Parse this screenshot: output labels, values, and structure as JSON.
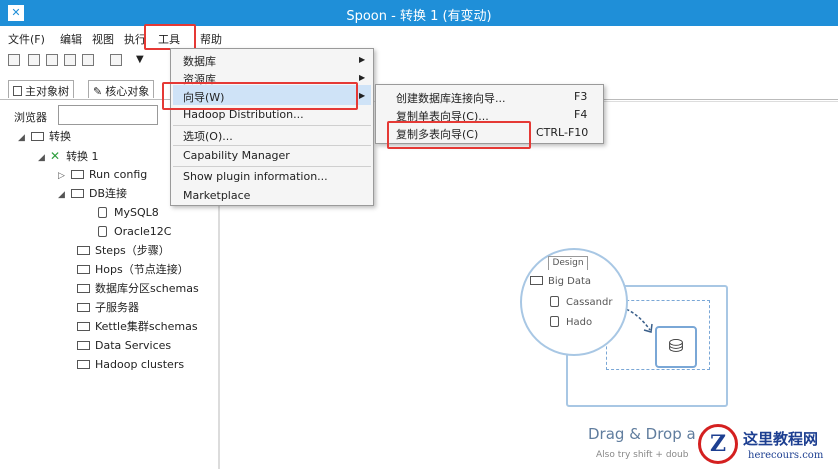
{
  "title_bar": {
    "title": "Spoon - 转换 1 (有变动)",
    "logo": "spoon-logo"
  },
  "menu_bar": {
    "items": [
      "文件(F)",
      "编辑",
      "视图",
      "执行",
      "工具",
      "帮助"
    ],
    "highlighted_item": "工具",
    "highlight_color": "#e53935"
  },
  "tabs": [
    "主对象树",
    "核心对象"
  ],
  "browser": {
    "label": "浏览器",
    "value": ""
  },
  "tree": {
    "root": "转换",
    "transformation": "转换 1",
    "run_config": "Run config",
    "db_connections": "DB连接",
    "db_items": [
      "MySQL8",
      "Oracle12C"
    ],
    "folders": [
      "Steps（步骤）",
      "Hops（节点连接）",
      "数据库分区schemas",
      "子服务器",
      "Kettle集群schemas",
      "Data Services",
      "Hadoop clusters"
    ]
  },
  "tools_menu": {
    "items": [
      "数据库",
      "资源库",
      "向导(W)",
      "Hadoop Distribution...",
      "选项(O)...",
      "Capability Manager",
      "Show plugin information...",
      "Marketplace"
    ],
    "selected": "向导(W)"
  },
  "wizard_submenu": {
    "items": [
      {
        "label": "创建数据库连接向导...",
        "shortcut": "F3"
      },
      {
        "label": "复制单表向导(C)...",
        "shortcut": "F4"
      },
      {
        "label": "复制多表向导(C)",
        "shortcut": "CTRL-F10"
      }
    ],
    "highlighted": "复制多表向导(C)"
  },
  "canvas": {
    "design_tab": "Design",
    "tree_items": [
      "Big Data",
      "Cassandr",
      "Hado"
    ],
    "drag_title": "Drag & Drop a",
    "drag_subtitle": "Also try shift + doub"
  },
  "watermark": {
    "name": "这里教程网",
    "url": "herecours.com",
    "logo_letter": "Z"
  },
  "colors": {
    "title_bar": "#1f8fd8",
    "highlight_box": "#e53935",
    "menu_selected": "#cfe3f7",
    "illustration": "#a8c7e4"
  }
}
